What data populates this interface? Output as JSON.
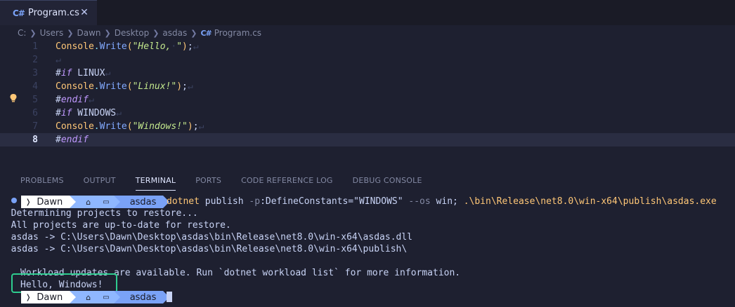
{
  "tab": {
    "badge": "C#",
    "label": "Program.cs",
    "close": "✕"
  },
  "breadcrumb": [
    "C:",
    "Users",
    "Dawn",
    "Desktop",
    "asdas",
    "Program.cs"
  ],
  "breadcrumb_cs_badge": "C#",
  "editor": {
    "current_line": 8,
    "line_numbers": [
      "1",
      "2",
      "3",
      "4",
      "5",
      "6",
      "7",
      "8"
    ]
  },
  "panel_tabs": [
    "PROBLEMS",
    "OUTPUT",
    "TERMINAL",
    "PORTS",
    "CODE REFERENCE LOG",
    "DEBUG CONSOLE"
  ],
  "active_panel_tab": "TERMINAL",
  "terminal": {
    "prompt": {
      "user": "Dawn",
      "dir": "asdas"
    },
    "command": {
      "name": "dotnet",
      "sub": "publish",
      "flag1": "-p",
      "arg1": ":DefineConstants=\"WINDOWS\"",
      "flag2": "--os",
      "arg2": "win;",
      "exe": ".\\bin\\Release\\net8.0\\win-x64\\publish\\asdas.exe"
    },
    "output": [
      "  Determining projects to restore...",
      "  All projects are up-to-date for restore.",
      "  asdas -> C:\\Users\\Dawn\\Desktop\\asdas\\bin\\Release\\net8.0\\win-x64\\asdas.dll",
      "  asdas -> C:\\Users\\Dawn\\Desktop\\asdas\\bin\\Release\\net8.0\\win-x64\\publish\\"
    ],
    "workload_msg": "Workload updates are available. Run `dotnet workload list` for more information.",
    "program_output": "Hello, Windows!"
  },
  "colors": {
    "highlight_box": "#2ecc8f",
    "editor_bg": "#1e2030",
    "prompt_blue": "#7aa2f7"
  }
}
